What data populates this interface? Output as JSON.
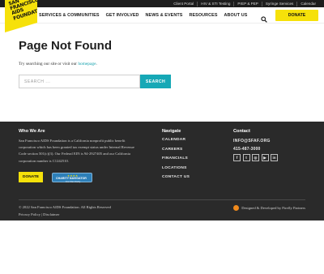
{
  "topbar": {
    "links": [
      "Client Portal",
      "HIV & STI Testing",
      "PrEP & PEP",
      "Syringe Services",
      "Calendar"
    ]
  },
  "logo": {
    "lines": [
      "SAN",
      "FRANCISCO",
      "AIDS",
      "FOUNDATION"
    ],
    "alt": "San Francisco AIDS Foundation"
  },
  "nav": {
    "items": [
      "SERVICES & COMMUNITIES",
      "GET INVOLVED",
      "NEWS & EVENTS",
      "RESOURCES",
      "ABOUT US"
    ],
    "search_icon": "search-icon",
    "donate_label": "DONATE"
  },
  "main": {
    "title": "Page Not Found",
    "hint_prefix": "Try searching our site or visit our ",
    "hint_link": "homepage",
    "hint_suffix": ".",
    "search_placeholder": "SEARCH ...",
    "search_button": "SEARCH"
  },
  "footer": {
    "about_heading": "Who We Are",
    "about_text": "San Francisco AIDS Foundation is a California nonprofit public benefit corporation which has been granted tax exempt status under Internal Revenue Code section 501(c)(3). Our Federal EIN is 94-2927405 and our California corporation number is C1242510.",
    "donate_label": "DONATE",
    "charity_stars": "★★★★",
    "charity_name": "CHARITY NAVIGATOR",
    "charity_sub": "Four Star Charity",
    "navigate_heading": "Navigate",
    "navigate_items": [
      "CALENDAR",
      "CAREERS",
      "FINANCIALS",
      "LOCATIONS",
      "CONTACT US"
    ],
    "contact_heading": "Contact",
    "email": "INFO@SFAF.ORG",
    "phone": "415-487-3000",
    "socials": [
      "facebook-icon",
      "twitter-icon",
      "instagram-icon",
      "youtube-icon",
      "linkedin-icon"
    ],
    "copyright": "© 2022 San Francisco AIDS Foundation. All Rights Reserved",
    "privacy": "Privacy Policy",
    "separator": "|",
    "disclaimer": "Disclaimer",
    "credit": "Designed & Developed by Firefly Partners"
  },
  "colors": {
    "brand_yellow": "#f6e10a",
    "teal": "#16a8b6",
    "footer_bg": "#2a2a2a",
    "topbar_bg": "#1d1d1d"
  }
}
